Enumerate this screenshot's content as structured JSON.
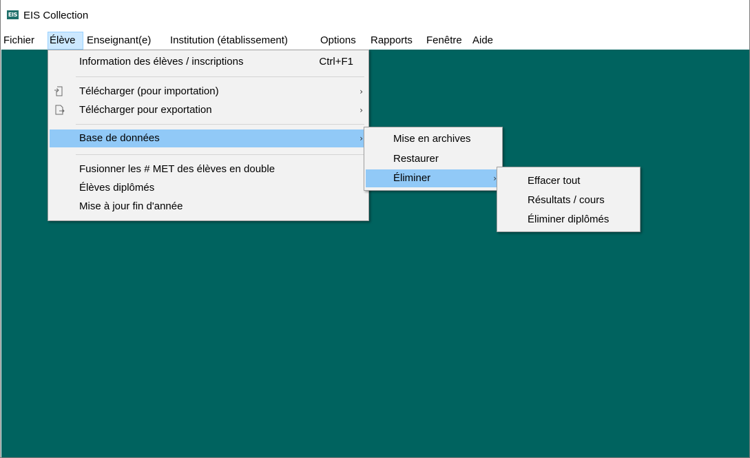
{
  "window": {
    "icon_text": "EIS",
    "title": "EIS Collection"
  },
  "menubar": {
    "items": [
      {
        "label": "Fichier"
      },
      {
        "label": "Élève"
      },
      {
        "label": "Enseignant(e)"
      },
      {
        "label": "Institution (établissement)"
      },
      {
        "label": "Options"
      },
      {
        "label": "Rapports"
      },
      {
        "label": "Fenêtre"
      },
      {
        "label": "Aide"
      }
    ]
  },
  "eleve_menu": {
    "items": [
      {
        "label": "Information des élèves / inscriptions",
        "shortcut": "Ctrl+F1"
      },
      {
        "label": "Télécharger (pour importation)",
        "icon": "import-icon",
        "submenu": true
      },
      {
        "label": "Télécharger pour exportation",
        "icon": "export-icon",
        "submenu": true
      },
      {
        "label": "Base de données",
        "submenu": true,
        "highlighted": true
      },
      {
        "label": "Fusionner les # MET des élèves en double"
      },
      {
        "label": "Élèves diplômés"
      },
      {
        "label": "Mise à jour fin d'année"
      }
    ]
  },
  "database_menu": {
    "items": [
      {
        "label": "Mise en archives"
      },
      {
        "label": "Restaurer"
      },
      {
        "label": "Éliminer",
        "submenu": true,
        "highlighted": true
      }
    ]
  },
  "eliminate_menu": {
    "items": [
      {
        "label": "Effacer tout"
      },
      {
        "label": "Résultats / cours"
      },
      {
        "label": "Éliminer diplômés"
      }
    ]
  },
  "submenu_arrow": "›",
  "colors": {
    "workspace": "#00635f",
    "menu_bg": "#f2f2f2",
    "highlight": "#91c9f7",
    "menubar_open": "#cce8ff"
  }
}
